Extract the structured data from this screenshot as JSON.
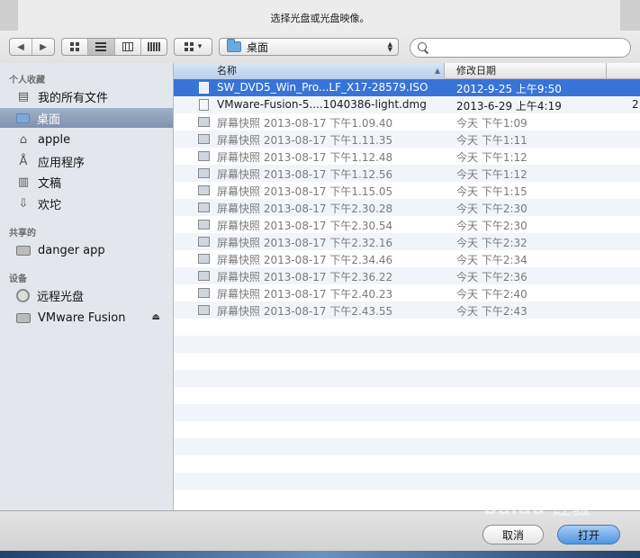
{
  "window": {
    "title": "选择光盘或光盘映像。"
  },
  "toolbar": {
    "back_label": "◀",
    "forward_label": "▶",
    "arrange_arrow": "▾",
    "path": {
      "label": "桌面",
      "icon": "folder-icon"
    },
    "search": {
      "value": "",
      "placeholder": ""
    }
  },
  "sidebar": {
    "sections": [
      {
        "title": "个人收藏",
        "items": [
          {
            "label": "我的所有文件",
            "icon": "all-files-icon",
            "glyph": "▤"
          },
          {
            "label": "桌面",
            "icon": "folder-icon",
            "glyph": ""
          },
          {
            "label": "apple",
            "icon": "home-icon",
            "glyph": "⌂"
          },
          {
            "label": "应用程序",
            "icon": "applications-icon",
            "glyph": "Å"
          },
          {
            "label": "文稿",
            "icon": "documents-icon",
            "glyph": "▥"
          },
          {
            "label": "欢坨",
            "icon": "downloads-icon",
            "glyph": "⇩"
          }
        ]
      },
      {
        "title": "共享的",
        "items": [
          {
            "label": "danger app",
            "icon": "shared-computer-icon",
            "glyph": ""
          }
        ]
      },
      {
        "title": "设备",
        "items": [
          {
            "label": "远程光盘",
            "icon": "remote-disc-icon",
            "glyph": ""
          },
          {
            "label": "VMware Fusion",
            "icon": "drive-icon",
            "glyph": "",
            "eject": "⏏"
          }
        ]
      }
    ]
  },
  "file_list": {
    "columns": {
      "name": "名称",
      "date": "修改日期",
      "sort_indicator": "▲"
    },
    "rows": [
      {
        "name": "SW_DVD5_Win_Pro...LF_X17-28579.ISO",
        "date": "2012-9-25 上午9:50",
        "extra": ""
      },
      {
        "name": "VMware-Fusion-5....1040386-light.dmg",
        "date": "2013-6-29 上午4:19",
        "extra": "2"
      },
      {
        "name": "屏幕快照 2013-08-17 下午1.09.40",
        "date": "今天 下午1:09",
        "extra": ""
      },
      {
        "name": "屏幕快照 2013-08-17 下午1.11.35",
        "date": "今天 下午1:11",
        "extra": ""
      },
      {
        "name": "屏幕快照 2013-08-17 下午1.12.48",
        "date": "今天 下午1:12",
        "extra": ""
      },
      {
        "name": "屏幕快照 2013-08-17 下午1.12.56",
        "date": "今天 下午1:12",
        "extra": ""
      },
      {
        "name": "屏幕快照 2013-08-17 下午1.15.05",
        "date": "今天 下午1:15",
        "extra": ""
      },
      {
        "name": "屏幕快照 2013-08-17 下午2.30.28",
        "date": "今天 下午2:30",
        "extra": ""
      },
      {
        "name": "屏幕快照 2013-08-17 下午2.30.54",
        "date": "今天 下午2:30",
        "extra": ""
      },
      {
        "name": "屏幕快照 2013-08-17 下午2.32.16",
        "date": "今天 下午2:32",
        "extra": ""
      },
      {
        "name": "屏幕快照 2013-08-17 下午2.34.46",
        "date": "今天 下午2:34",
        "extra": ""
      },
      {
        "name": "屏幕快照 2013-08-17 下午2.36.22",
        "date": "今天 下午2:36",
        "extra": ""
      },
      {
        "name": "屏幕快照 2013-08-17 下午2.40.23",
        "date": "今天 下午2:40",
        "extra": ""
      },
      {
        "name": "屏幕快照 2013-08-17 下午2.43.55",
        "date": "今天 下午2:43",
        "extra": ""
      }
    ]
  },
  "footer": {
    "cancel_label": "取消",
    "open_label": "打开",
    "watermark": "Baidu 经验"
  },
  "colors": {
    "selection": "#3874d7",
    "sidebar_bg": "#e3e7ed",
    "sidebar_selected": "#7f92ae"
  }
}
